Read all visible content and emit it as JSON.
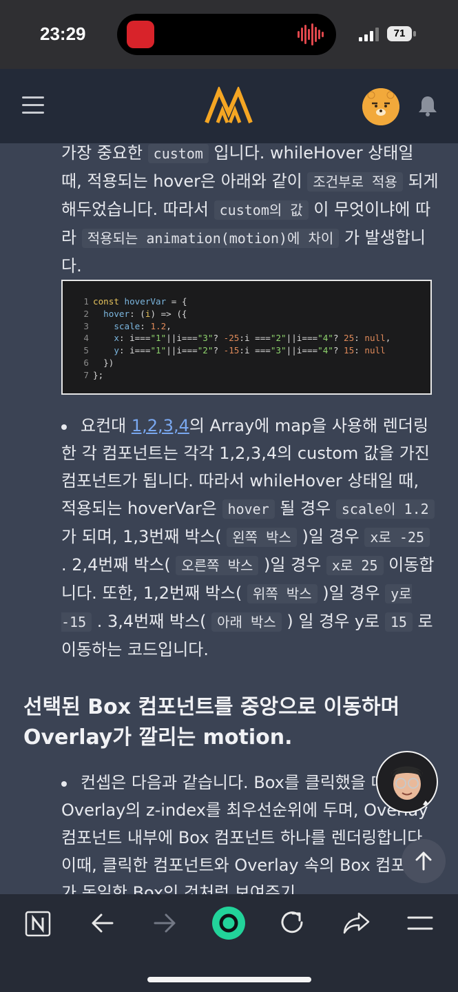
{
  "status_bar": {
    "time": "23:29",
    "battery": "71"
  },
  "colors": {
    "header_bg": "#232a38",
    "content_bg": "#3b4354",
    "logo_orange": "#f5a623",
    "link": "#7aa8f0",
    "toolbar_bg": "#262b36"
  },
  "header": {
    "menu_icon": "hamburger-icon",
    "logo_icon": "site-logo",
    "avatar_icon": "avatar-bear",
    "bell_icon": "bell-icon"
  },
  "article": {
    "para1": {
      "t1": "가장 중요한 ",
      "c1": "custom",
      "t2": " 입니다. whileHover 상태일 때, 적용되는 hover은 아래와 같이 ",
      "c2": "조건부로 적용",
      "t3": " 되게 해두었습니다. 따라서 ",
      "c3": "custom의 값",
      "t4": " 이 무엇이냐에 따라 ",
      "c4": "적용되는 animation(motion)에 차이",
      "t5": " 가 발생합니다."
    },
    "code": {
      "lines": [
        {
          "n": "1",
          "text": "const hoverVar = {"
        },
        {
          "n": "2",
          "text": "  hover: (i) => ({"
        },
        {
          "n": "3",
          "text": "    scale: 1.2,"
        },
        {
          "n": "4",
          "text": "    x: i===\"1\"||i===\"3\"? -25:i ===\"2\"||i===\"4\"? 25: null,"
        },
        {
          "n": "5",
          "text": "    y: i===\"1\"||i===\"2\"? -15:i ===\"3\"||i===\"4\"? 15: null"
        },
        {
          "n": "6",
          "text": "  })"
        },
        {
          "n": "7",
          "text": "};"
        }
      ]
    },
    "bullet1": {
      "t0": "요컨대 ",
      "link": "1,2,3,4",
      "t1": "의 Array에 map을 사용해 렌더링한 각 컴포넌트는 각각 1,2,3,4의 custom 값을 가진 컴포넌트가 됩니다. 따라서 whileHover 상태일 때, 적용되는 hoverVar은 ",
      "c1": "hover",
      "t2": " 될 경우 ",
      "c2": "scale이 1.2",
      "t3": " 가 되며, 1,3번째 박스( ",
      "c3": "왼쪽 박스",
      "t4": " )일 경우 ",
      "c4": "x로 -25",
      "t5": " . 2,4번째 박스( ",
      "c5": "오른쪽 박스",
      "t6": " )일 경우 ",
      "c6": "x로 25",
      "t7": " 이동합니다. 또한, 1,2번째 박스( ",
      "c7": "위쪽 박스",
      "t8": " )일 경우 ",
      "c8": "y로 -15",
      "t9": " . 3,4번째 박스( ",
      "c9": "아래 박스",
      "t10": " ) 일 경우 y로 ",
      "c10": "15",
      "t11": " 로 이동하는 코드입니다."
    },
    "heading": "선택된 Box 컴포넌트를 중앙으로 이동하며 Overlay가 깔리는 motion.",
    "bullet2": "컨셉은 다음과 같습니다. Box를 클릭했을 때 Overlay의 z-index를 최우선순위에 두며, Overlay 컴포넌트 내부에 Box 컴포넌트 하나를 렌더링합니다. 이때, 클릭한 컴포넌트와 Overlay 속의 Box 컴포넌트가 동일한 Box인 것처럼 보여주기"
  },
  "toolbar": {
    "icons": [
      "notion-icon",
      "back-icon",
      "forward-icon",
      "home-circle-icon",
      "reload-icon",
      "share-icon",
      "menu-icon"
    ]
  }
}
